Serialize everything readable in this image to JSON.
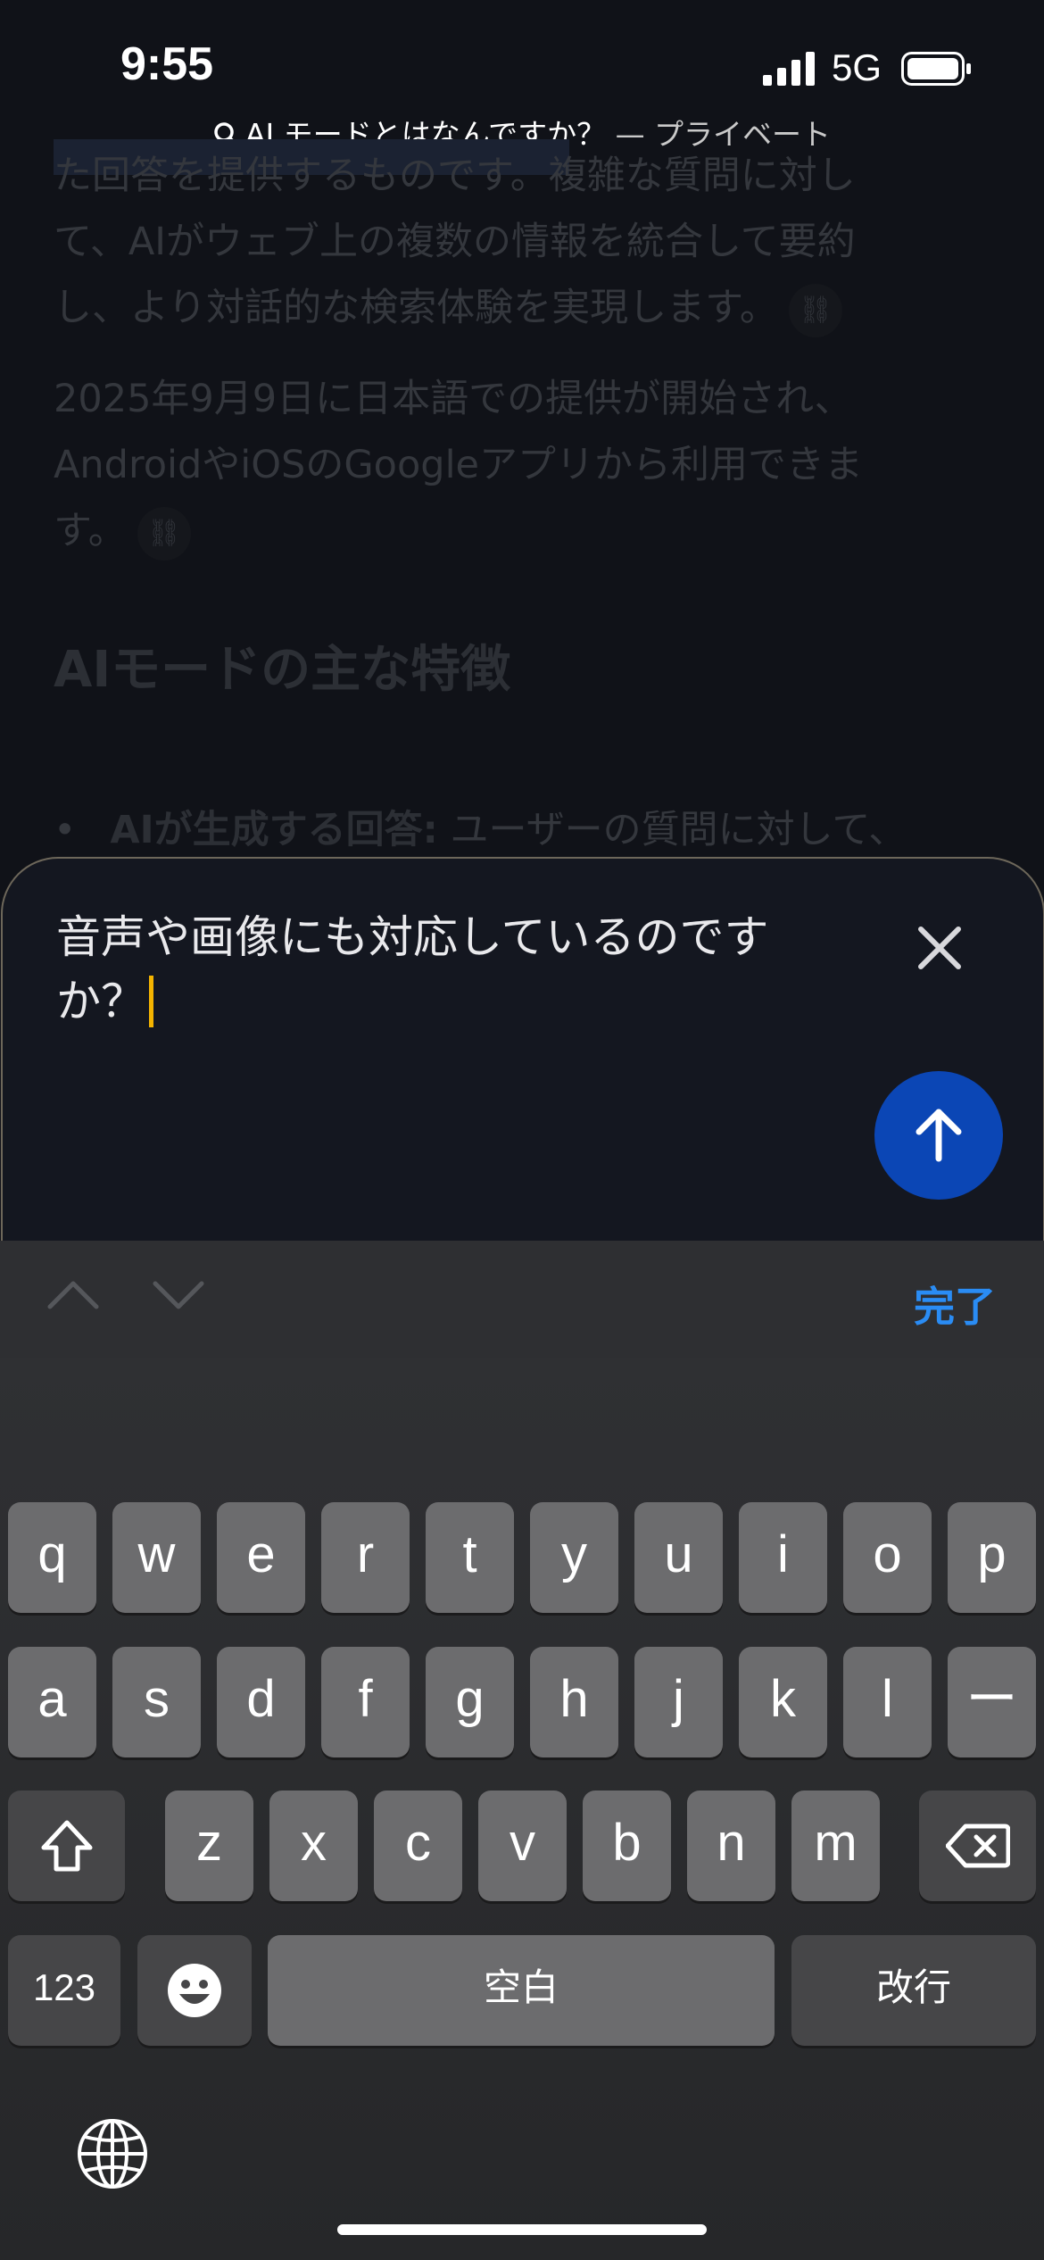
{
  "status_bar": {
    "time": "9:55",
    "network": "5G"
  },
  "url_bar": {
    "query": "AI モードとはなんですか？",
    "mode": " — プライベート"
  },
  "article": {
    "para1_line1": "た回答を提供するものです。複雑な質問に対し",
    "para1_line2": "て、AIがウェブ上の複数の情報を統合して要約",
    "para1_line3": "し、より対話的な検索体験を実現します。",
    "para2_line1": "2025年9月9日に日本語での提供が開始され、",
    "para2_line2": "AndroidやiOSのGoogleアプリから利用できま",
    "para2_line3": "す。",
    "heading": "AIモードの主な特徴",
    "bullet_bold": "AIが生成する回答:",
    "bullet_text": " ユーザーの質問に対して、"
  },
  "input": {
    "text_line1": "音声や画像にも対応しているのです",
    "text_line2": "か？"
  },
  "accessory": {
    "done_label": "完了"
  },
  "keyboard": {
    "row1": [
      "q",
      "w",
      "e",
      "r",
      "t",
      "y",
      "u",
      "i",
      "o",
      "p"
    ],
    "row2": [
      "a",
      "s",
      "d",
      "f",
      "g",
      "h",
      "j",
      "k",
      "l",
      "ー"
    ],
    "row3": [
      "z",
      "x",
      "c",
      "v",
      "b",
      "n",
      "m"
    ],
    "numbers_key": "123",
    "space_key": "空白",
    "return_key": "改行"
  },
  "colors": {
    "accent": "#2a8cf4",
    "send_button": "#0b46b5",
    "caret": "#f4b400"
  }
}
